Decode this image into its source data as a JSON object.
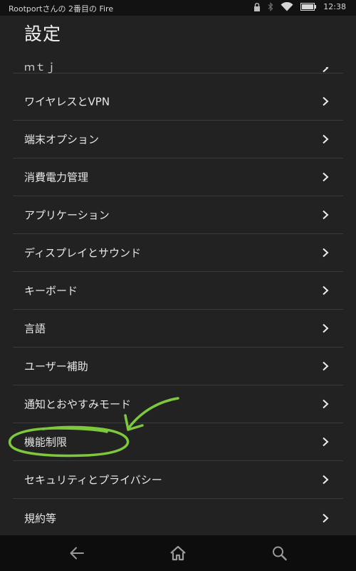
{
  "status_bar": {
    "device_name": "Rootportさんの 2番目の Fire",
    "time": "12:38",
    "icons": [
      "lock-icon",
      "bluetooth-icon",
      "wifi-icon",
      "battery-icon"
    ]
  },
  "header": {
    "title": "設定"
  },
  "settings": {
    "partial_item": "ｍｔｊ",
    "items": [
      {
        "label": "ワイヤレスとVPN"
      },
      {
        "label": "端末オプション"
      },
      {
        "label": "消費電力管理"
      },
      {
        "label": "アプリケーション"
      },
      {
        "label": "ディスプレイとサウンド"
      },
      {
        "label": "キーボード"
      },
      {
        "label": "言語"
      },
      {
        "label": "ユーザー補助"
      },
      {
        "label": "通知とおやすみモード"
      },
      {
        "label": "機能制限"
      },
      {
        "label": "セキュリティとプライバシー"
      },
      {
        "label": "規約等"
      }
    ]
  },
  "annotation": {
    "color": "#7ec83c",
    "highlighted_item": "機能制限"
  },
  "nav_bar": {
    "icons": [
      "back-icon",
      "home-icon",
      "search-icon"
    ]
  },
  "colors": {
    "background": "#222222",
    "divider": "#3a3a3a",
    "text": "#e8e8e8"
  }
}
